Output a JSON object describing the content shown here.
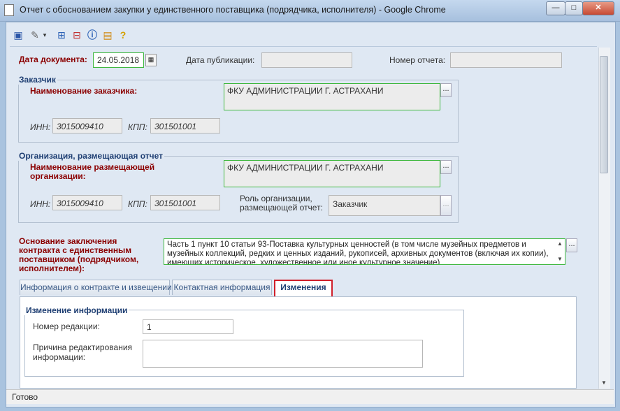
{
  "window": {
    "title": "Отчет с обоснованием закупки у единственного поставщика (подрядчика, исполнителя) - Google Chrome",
    "minimize": "—",
    "maximize": "□",
    "close": "✕"
  },
  "toolbar": {
    "icons": [
      "save-icon",
      "attach-icon",
      "dropdown-icon",
      "tree-icon",
      "tree-remove-icon",
      "info-icon",
      "export-icon",
      "help-icon"
    ]
  },
  "header": {
    "doc_date_label": "Дата документа:",
    "doc_date_value": "24.05.2018",
    "pub_date_label": "Дата публикации:",
    "pub_date_value": "",
    "report_no_label": "Номер отчета:",
    "report_no_value": ""
  },
  "customer": {
    "group_title": "Заказчик",
    "name_label": "Наименование заказчика:",
    "name_value": "ФКУ АДМИНИСТРАЦИИ Г. АСТРАХАНИ",
    "inn_label": "ИНН:",
    "inn_value": "3015009410",
    "kpp_label": "КПП:",
    "kpp_value": "301501001",
    "dots": "..."
  },
  "placing_org": {
    "group_title": "Организация, размещающая отчет",
    "name_label": "Наименование размещающей организации:",
    "name_value": "ФКУ АДМИНИСТРАЦИИ Г. АСТРАХАНИ",
    "inn_label": "ИНН:",
    "inn_value": "3015009410",
    "kpp_label": "КПП:",
    "kpp_value": "301501001",
    "role_label": "Роль организации, размещающей отчет:",
    "role_value": "Заказчик",
    "dots": "..."
  },
  "basis": {
    "label": "Основание заключения контракта с единственным поставщиком (подрядчиком, исполнителем):",
    "value": "Часть 1 пункт 10 статьи 93-Поставка культурных ценностей (в том числе музейных предметов и музейных коллекций, редких и ценных изданий, рукописей, архивных документов (включая их копии), имеющих историческое, художественное или иное культурное значение)",
    "dots": "..."
  },
  "tabs": [
    {
      "label": "Информация о контракте и извещении"
    },
    {
      "label": "Контактная информация"
    },
    {
      "label": "Изменения"
    }
  ],
  "changes": {
    "group_title": "Изменение информации",
    "edition_label": "Номер редакции:",
    "edition_value": "1",
    "reason_label": "Причина редактирования информации:",
    "reason_value": ""
  },
  "status": {
    "text": "Готово"
  }
}
